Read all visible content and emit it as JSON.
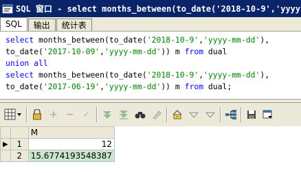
{
  "window": {
    "title": "SQL 窗口 - select months_between(to_date('2018-10-9','yyyy-mm-"
  },
  "tabs": [
    {
      "label": "SQL"
    },
    {
      "label": "输出"
    },
    {
      "label": "统计表"
    }
  ],
  "editor": {
    "lines": [
      [
        {
          "t": "select ",
          "c": "kw"
        },
        {
          "t": "months_between(to_date(",
          "c": "plain"
        },
        {
          "t": "'2018-10-9'",
          "c": "str"
        },
        {
          "t": ",",
          "c": "plain"
        },
        {
          "t": "'yyyy-mm-dd'",
          "c": "str"
        },
        {
          "t": "),",
          "c": "plain"
        }
      ],
      [
        {
          "t": "to_date(",
          "c": "plain"
        },
        {
          "t": "'2017-10-09'",
          "c": "str"
        },
        {
          "t": ",",
          "c": "plain"
        },
        {
          "t": "'yyyy-mm-dd'",
          "c": "str"
        },
        {
          "t": ")) m ",
          "c": "plain"
        },
        {
          "t": "from",
          "c": "kw"
        },
        {
          "t": " dual",
          "c": "plain"
        }
      ],
      [
        {
          "t": "union all",
          "c": "kw"
        }
      ],
      [
        {
          "t": "select ",
          "c": "kw"
        },
        {
          "t": "months_between(to_date(",
          "c": "plain"
        },
        {
          "t": "'2018-10-9'",
          "c": "str"
        },
        {
          "t": ",",
          "c": "plain"
        },
        {
          "t": "'yyyy-mm-dd'",
          "c": "str"
        },
        {
          "t": "),",
          "c": "plain"
        }
      ],
      [
        {
          "t": "to_date(",
          "c": "plain"
        },
        {
          "t": "'2017-06-19'",
          "c": "str"
        },
        {
          "t": ",",
          "c": "plain"
        },
        {
          "t": "'yyyy-mm-dd'",
          "c": "str"
        },
        {
          "t": ")) m ",
          "c": "plain"
        },
        {
          "t": "from",
          "c": "kw"
        },
        {
          "t": " dual;",
          "c": "plain"
        }
      ]
    ]
  },
  "toolbar": {
    "icons": [
      "grid-menu-icon",
      "lock-icon",
      "add-row-icon",
      "delete-row-icon",
      "post-icon",
      "fetch-next-icon",
      "fetch-last-icon",
      "find-icon",
      "clear-icon",
      "print-icon",
      "query-by-example-icon",
      "next-icon",
      "tree-icon",
      "save-icon",
      "export-icon"
    ]
  },
  "results": {
    "column": "M",
    "rows": [
      {
        "num": "1",
        "value": "12",
        "indicator": "▶"
      },
      {
        "num": "2",
        "value": "15.6774193548387",
        "indicator": ""
      }
    ]
  },
  "colors": {
    "titlebar": "#0a246a",
    "keyword": "#0000ff",
    "string": "#008000",
    "chrome": "#ece9d8"
  }
}
